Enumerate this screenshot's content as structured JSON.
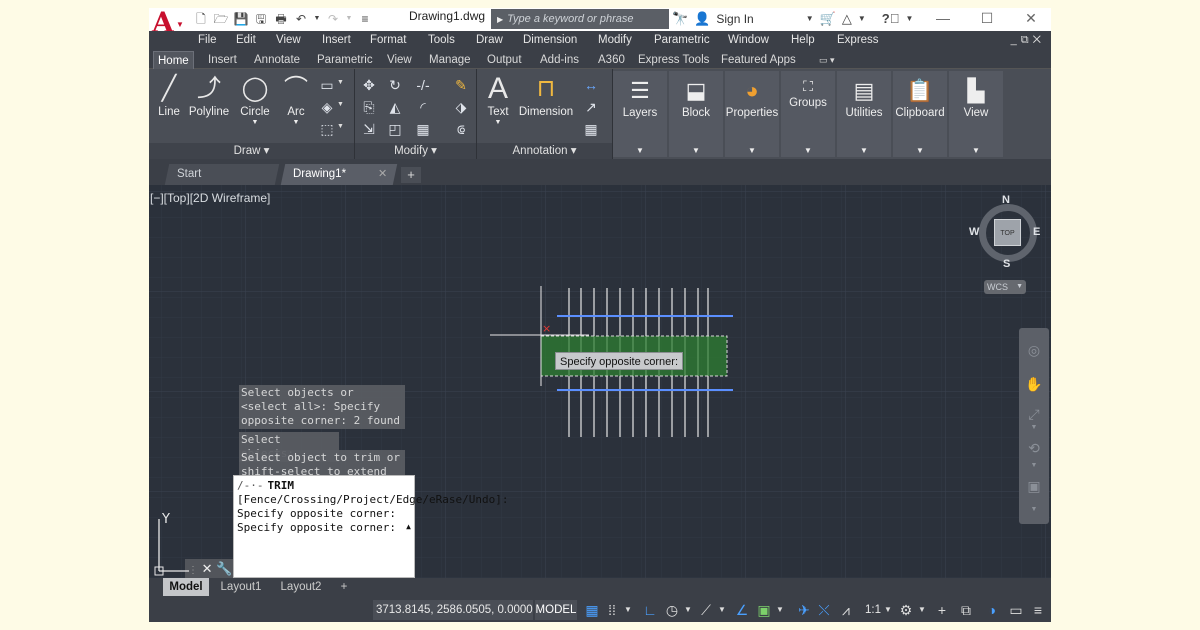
{
  "titlebar": {
    "title": "Drawing1.dwg",
    "search_placeholder": "Type a keyword or phrase",
    "sign_in": "Sign In"
  },
  "menu": [
    "File",
    "Edit",
    "View",
    "Insert",
    "Format",
    "Tools",
    "Draw",
    "Dimension",
    "Modify",
    "Parametric",
    "Window",
    "Help",
    "Express"
  ],
  "ribbon_tabs": [
    "Home",
    "Insert",
    "Annotate",
    "Parametric",
    "View",
    "Manage",
    "Output",
    "Add-ins",
    "A360",
    "Express Tools",
    "Featured Apps"
  ],
  "ribbon": {
    "draw_tools": [
      "Line",
      "Polyline",
      "Circle",
      "Arc"
    ],
    "draw_panel": "Draw",
    "modify_panel": "Modify",
    "annotation_tools": [
      "Text",
      "Dimension"
    ],
    "annotation_panel": "Annotation",
    "groups": [
      "Layers",
      "Block",
      "Properties",
      "Groups",
      "Utilities",
      "Clipboard",
      "View"
    ]
  },
  "file_tabs": {
    "start": "Start",
    "drawing": "Drawing1*"
  },
  "viewport": {
    "label": "[−][Top][2D Wireframe]",
    "tooltip": "Specify opposite corner:",
    "viewcube": {
      "top": "TOP",
      "n": "N",
      "s": "S",
      "e": "E",
      "w": "W",
      "wcs": "WCS"
    },
    "ucs_y": "Y"
  },
  "command": {
    "history": [
      "Select objects or <select all>: Specify opposite corner: 2 found",
      "Select objects:",
      "Select object to trim or shift-select to extend or"
    ],
    "current_name": "TRIM",
    "current_text": "[Fence/Crossing/Project/Edge/eRase/Undo]: Specify opposite corner: Specify opposite corner:"
  },
  "layout_tabs": [
    "Model",
    "Layout1",
    "Layout2"
  ],
  "status": {
    "coords": "3713.8145, 2586.0505, 0.0000",
    "model": "MODEL",
    "scale": "1:1"
  },
  "colors": {
    "accent_red": "#c8102e",
    "viewport_bg": "#2b313b",
    "selection_green": "#2e7d32"
  }
}
